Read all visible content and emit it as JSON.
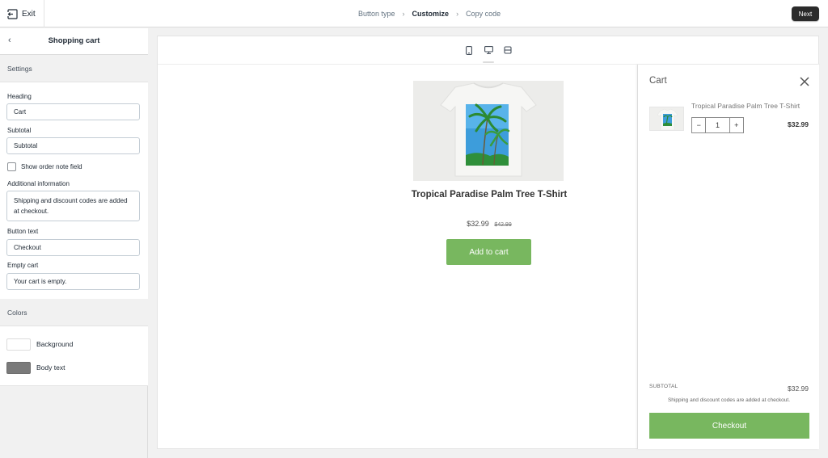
{
  "topbar": {
    "exit_label": "Exit",
    "steps": [
      "Button type",
      "Customize",
      "Copy code"
    ],
    "active_step": "Customize",
    "next_label": "Next"
  },
  "panel": {
    "title": "Shopping cart",
    "settings_heading": "Settings",
    "fields": {
      "heading_label": "Heading",
      "heading_value": "Cart",
      "subtotal_label": "Subtotal",
      "subtotal_value": "Subtotal",
      "order_note_label": "Show order note field",
      "order_note_checked": false,
      "additional_label": "Additional information",
      "additional_value": "Shipping and discount codes are added at checkout.",
      "button_text_label": "Button text",
      "button_text_value": "Checkout",
      "empty_cart_label": "Empty cart",
      "empty_cart_value": "Your cart is empty."
    },
    "colors_heading": "Colors",
    "colors": [
      {
        "label": "Background",
        "value": "#ffffff"
      },
      {
        "label": "Body text",
        "value": "#7a7a7a"
      }
    ]
  },
  "preview": {
    "devices": [
      "mobile-icon",
      "desktop-icon",
      "fullscreen-icon"
    ],
    "selected_device": "desktop-icon",
    "product": {
      "title": "Tropical Paradise Palm Tree T-Shirt",
      "price": "$32.99",
      "compare_price": "$42.99",
      "button": "Add to cart"
    },
    "cart": {
      "title": "Cart",
      "item_title": "Tropical Paradise Palm Tree T-Shirt",
      "quantity": "1",
      "minus": "−",
      "plus": "+",
      "item_price": "$32.99",
      "subtotal_label": "SUBTOTAL",
      "subtotal_value": "$32.99",
      "note": "Shipping and discount codes are added at checkout.",
      "checkout_label": "Checkout"
    }
  },
  "colors": {
    "accent_green": "#78b75f",
    "dark_button": "#2b2b2b"
  }
}
